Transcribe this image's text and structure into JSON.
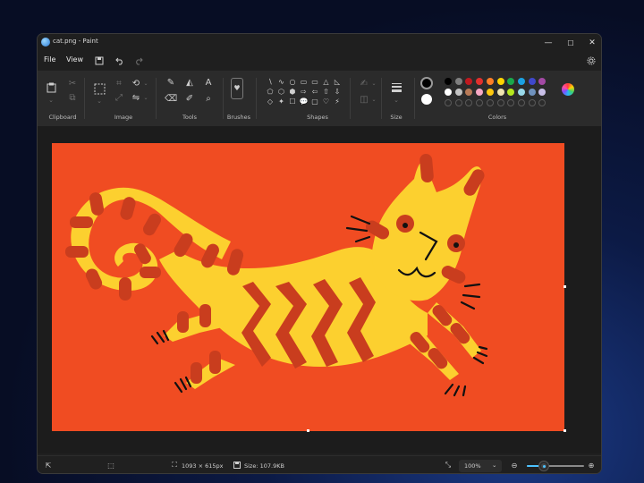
{
  "window": {
    "title": "cat.png - Paint",
    "controls": {
      "minimize": "—",
      "maximize": "☐",
      "close": "✕"
    }
  },
  "menu": {
    "file": "File",
    "view": "View",
    "save_icon": "save-icon",
    "undo_icon": "undo-icon",
    "redo_icon": "redo-icon",
    "settings_icon": "gear-icon"
  },
  "ribbon": {
    "groups": {
      "clipboard": "Clipboard",
      "image": "Image",
      "tools": "Tools",
      "brushes": "Brushes",
      "shapes": "Shapes",
      "size": "Size",
      "colors": "Colors"
    },
    "tool_glyphs": [
      "✎",
      "◭",
      "A",
      "⌫",
      "✐",
      "⌕"
    ],
    "shape_glyphs": [
      "∖",
      "∿",
      "○",
      "▭",
      "▭",
      "△",
      "◺",
      "⬠",
      "⬡",
      "⬢",
      "⇨",
      "⇦",
      "⇧",
      "⇩",
      "◇",
      "✦",
      "☐",
      "💬",
      "▢",
      "♡",
      "⚡"
    ],
    "palette_row1": [
      "#000000",
      "#7f7f7f",
      "#c0191f",
      "#e2302d",
      "#ff7f27",
      "#ffd400",
      "#1aa84b",
      "#1ba1e2",
      "#3f48cc",
      "#a349a4"
    ],
    "palette_row2": [
      "#ffffff",
      "#c3c3c3",
      "#b97a57",
      "#f7a8c4",
      "#ffc90e",
      "#efe4b0",
      "#b5e61d",
      "#99d9ea",
      "#7092be",
      "#c8bfe7"
    ],
    "primary_color": "#000000",
    "secondary_color": "#ffffff"
  },
  "canvas": {
    "background_color": "#f04c22",
    "cat_color": "#fcd02f",
    "stripe_color": "#c93d1e"
  },
  "status": {
    "dimensions": "1093 × 615px",
    "size": "Size: 107.9KB",
    "zoom": "100%",
    "zoom_level": 0.3
  }
}
